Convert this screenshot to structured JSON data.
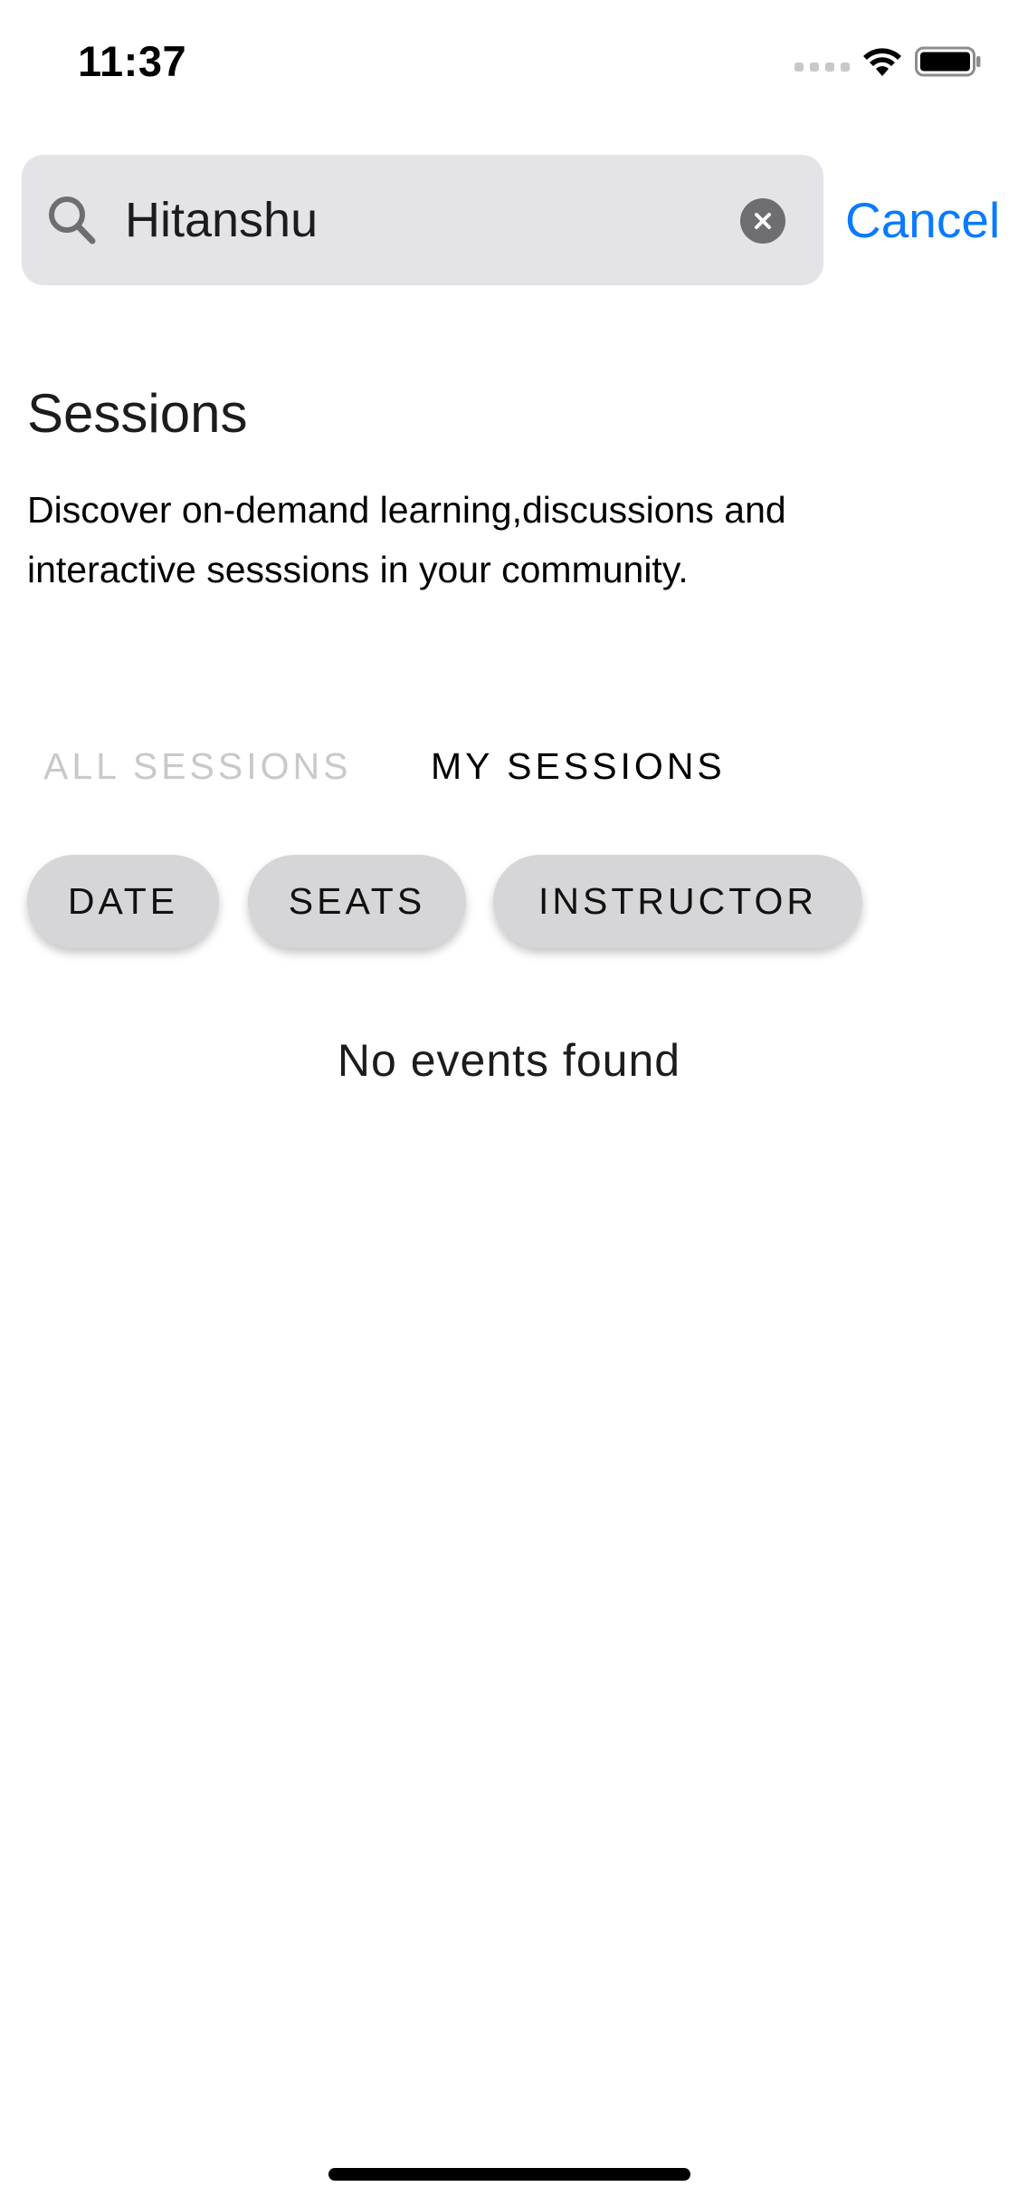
{
  "status_bar": {
    "time": "11:37",
    "signal_icon": "signal-icon",
    "wifi_icon": "wifi-icon",
    "battery_icon": "battery-icon"
  },
  "search": {
    "value": "Hitanshu",
    "search_icon": "search-icon",
    "clear_icon": "clear-icon",
    "cancel_label": "Cancel"
  },
  "page": {
    "title": "Sessions",
    "description": "Discover on-demand learning,discussions and interactive sesssions in your community."
  },
  "tabs": [
    {
      "label": "ALL SESSIONS",
      "active": false
    },
    {
      "label": "MY SESSIONS",
      "active": true
    }
  ],
  "filters": [
    {
      "label": "DATE"
    },
    {
      "label": "SEATS"
    },
    {
      "label": "INSTRUCTOR"
    }
  ],
  "empty_state": {
    "message": "No events found"
  },
  "colors": {
    "accent": "#0a7aff",
    "search_bg": "#e3e3e8",
    "chip_bg": "#d6d6d8",
    "inactive_tab": "#c9c9cc"
  }
}
